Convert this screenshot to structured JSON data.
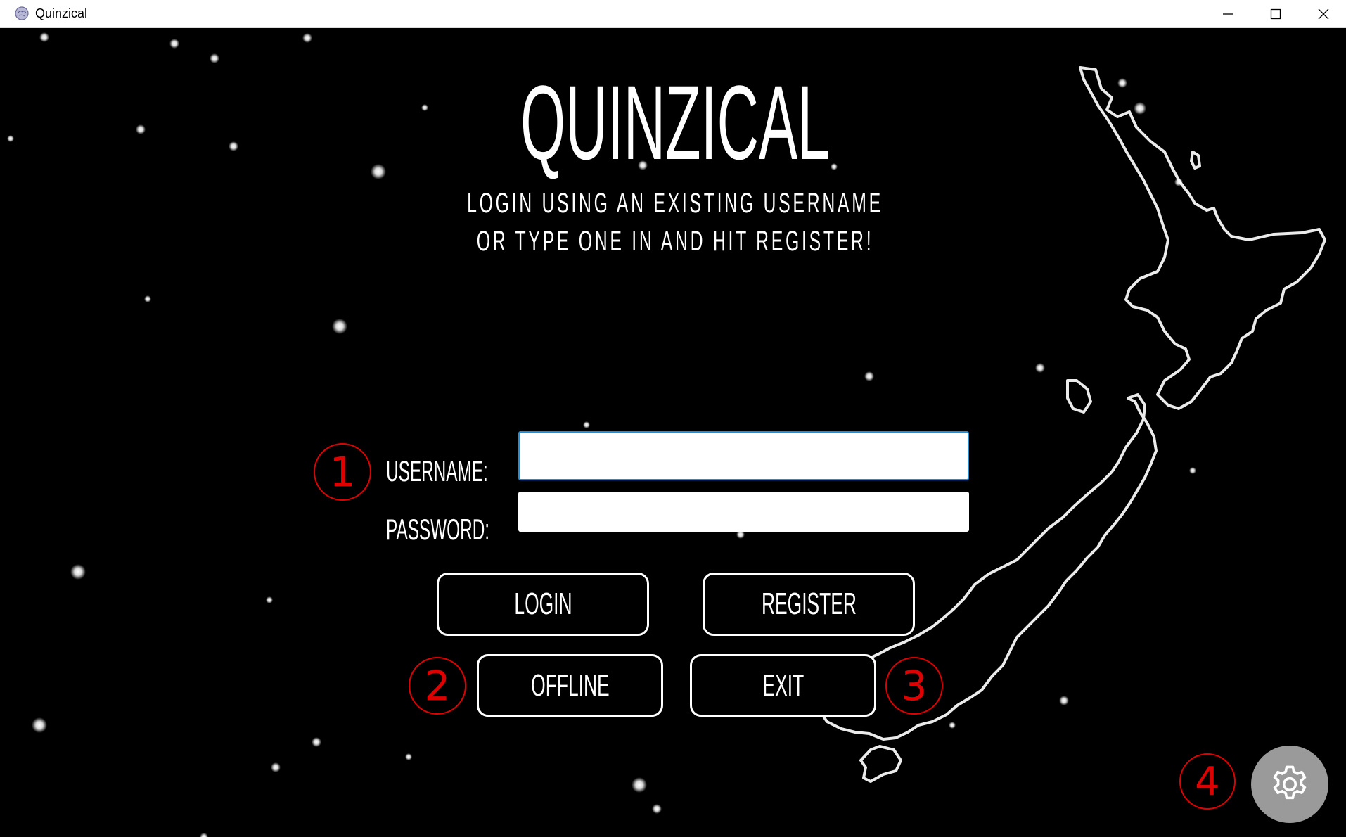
{
  "window": {
    "title": "Quinzical",
    "icon": "brain-icon",
    "controls": [
      "minimize-icon",
      "maximize-icon",
      "close-icon"
    ]
  },
  "app": {
    "title": "QUINZICAL",
    "subtitle_line1": "LOGIN USING AN EXISTING USERNAME",
    "subtitle_line2": "OR TYPE ONE IN AND HIT REGISTER!"
  },
  "form": {
    "username_label": "USERNAME:",
    "password_label": "PASSWORD:",
    "username_value": "",
    "password_value": ""
  },
  "buttons": {
    "login": "LOGIN",
    "register": "REGISTER",
    "offline": "OFFLINE",
    "exit": "EXIT",
    "settings_icon": "gear-icon"
  },
  "annotations": [
    "1",
    "2",
    "3",
    "4"
  ],
  "colors": {
    "background": "#000000",
    "foreground": "#ffffff",
    "annotation": "#e00000",
    "input_focus": "#1e8fd8",
    "settings_button": "#9a9a9a"
  }
}
